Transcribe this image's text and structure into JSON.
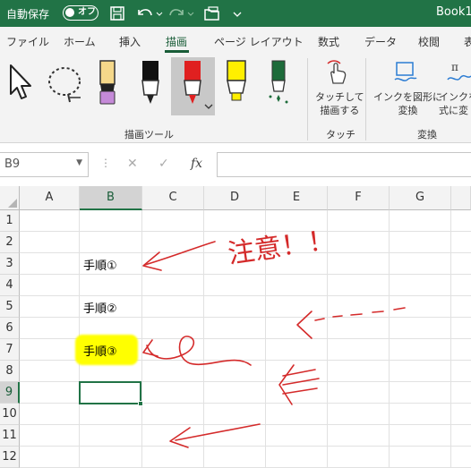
{
  "titlebar": {
    "autosave_label": "自動保存",
    "autosave_state": "オフ",
    "book_name": "Book1"
  },
  "tabs": [
    {
      "label": "ファイル"
    },
    {
      "label": "ホーム"
    },
    {
      "label": "挿入"
    },
    {
      "label": "描画"
    },
    {
      "label": "ページ レイアウト"
    },
    {
      "label": "数式"
    },
    {
      "label": "データ"
    },
    {
      "label": "校閲"
    },
    {
      "label": "表"
    }
  ],
  "ribbon": {
    "draw_tools_group": "描画ツール",
    "touch_button": "タッチして\n描画する",
    "touch_group": "タッチ",
    "ink_to_shape": "インクを図形に\n変換",
    "ink_to_math": "インクを\n式に変",
    "convert_group": "変換"
  },
  "formula_bar": {
    "name_box": "B9",
    "fx": "fx",
    "cancel": "✕",
    "enter": "✓"
  },
  "columns": [
    "A",
    "B",
    "C",
    "D",
    "E",
    "F",
    "G"
  ],
  "rows": [
    "1",
    "2",
    "3",
    "4",
    "5",
    "6",
    "7",
    "8",
    "9",
    "10",
    "11",
    "12"
  ],
  "selected_cell": "B9",
  "cells": {
    "B3": "手順①",
    "B5": "手順②",
    "B7": "手順③"
  },
  "ink_annotation": "注意！！",
  "colors": {
    "excel_green": "#217346",
    "ink_red": "#d42a2a",
    "highlighter": "#ffff00"
  }
}
